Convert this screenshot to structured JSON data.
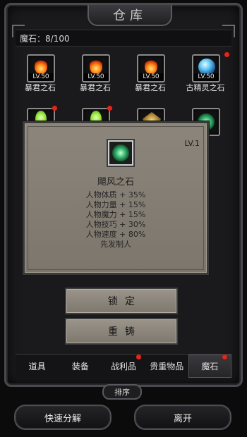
{
  "window": {
    "title": "仓库"
  },
  "stone_count": "魔石：8/100",
  "items": [
    {
      "name": "暴君之石",
      "level": "LV.50",
      "icon": "flame-stone-icon",
      "badge": false
    },
    {
      "name": "暴君之石",
      "level": "LV.50",
      "icon": "flame-stone-icon",
      "badge": false
    },
    {
      "name": "暴君之石",
      "level": "LV.50",
      "icon": "flame-stone-icon",
      "badge": false
    },
    {
      "name": "古精灵之石",
      "level": "LV.50",
      "icon": "spirit-orb-icon",
      "badge": true
    },
    {
      "name": "",
      "level": "",
      "icon": "green-gem-icon",
      "badge": true
    },
    {
      "name": "",
      "level": "",
      "icon": "green-gem-icon",
      "badge": true
    },
    {
      "name": "",
      "level": "",
      "icon": "gold-gem-icon",
      "badge": false
    },
    {
      "name": "",
      "level": "",
      "icon": "green-swirl-icon",
      "badge": false
    }
  ],
  "tooltip": {
    "level": "LV.1",
    "title": "飓风之石",
    "icon": "wind-stone-icon",
    "stats": [
      "人物体质 + 35%",
      "人物力量 + 15%",
      "人物魔力 + 15%",
      "人物技巧 + 30%",
      "人物速度 + 80%",
      "先发制人"
    ]
  },
  "actions": {
    "lock": "锁定",
    "reforge": "重铸"
  },
  "tabs": [
    {
      "label": "道具",
      "badge": false,
      "active": false
    },
    {
      "label": "装备",
      "badge": false,
      "active": false
    },
    {
      "label": "战利品",
      "badge": true,
      "active": false
    },
    {
      "label": "贵重物品",
      "badge": false,
      "active": false
    },
    {
      "label": "魔石",
      "badge": true,
      "active": true
    }
  ],
  "sort_label": "排序",
  "bottom": {
    "quick_decompose": "快速分解",
    "leave": "离开"
  },
  "colors": {
    "badge": "#e0271c",
    "panel": "#8b857b",
    "frame": "#4a4a4e"
  }
}
